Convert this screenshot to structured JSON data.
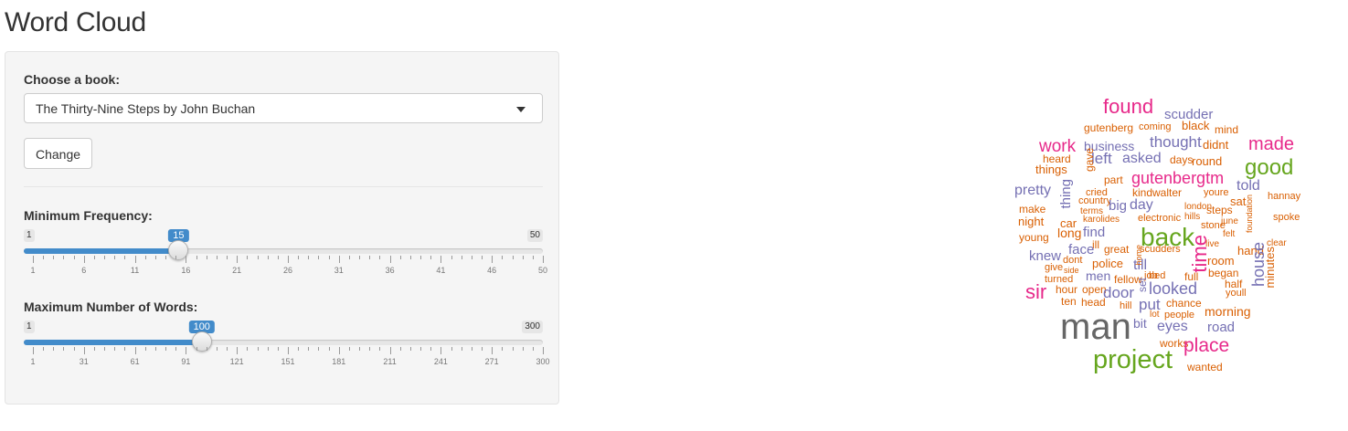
{
  "title": "Word Cloud",
  "book": {
    "label": "Choose a book:",
    "selected": "The Thirty-Nine Steps by John Buchan"
  },
  "change_button": "Change",
  "min_freq": {
    "label": "Minimum Frequency:",
    "min": 1,
    "max": 50,
    "value": 15,
    "min_label": "1",
    "max_label": "50",
    "value_label": "15",
    "ticks": [
      "1",
      "6",
      "11",
      "16",
      "21",
      "26",
      "31",
      "36",
      "41",
      "46",
      "50"
    ]
  },
  "max_words": {
    "label": "Maximum Number of Words:",
    "min": 1,
    "max": 300,
    "value": 100,
    "min_label": "1",
    "max_label": "300",
    "value_label": "100",
    "ticks": [
      "1",
      "31",
      "61",
      "91",
      "121",
      "151",
      "181",
      "211",
      "241",
      "271",
      "300"
    ]
  },
  "colors": {
    "accent": "#428bca",
    "cloud_palette": [
      "#666666",
      "#66a61e",
      "#e7298a",
      "#7570b3",
      "#d95f02"
    ]
  },
  "word_cloud": [
    {
      "text": "found",
      "color": "#e7298a"
    },
    {
      "text": "scudder",
      "color": "#7570b3"
    },
    {
      "text": "gutenberg",
      "color": "#d95f02"
    },
    {
      "text": "coming",
      "color": "#d95f02"
    },
    {
      "text": "black",
      "color": "#d95f02"
    },
    {
      "text": "mind",
      "color": "#d95f02"
    },
    {
      "text": "work",
      "color": "#e7298a"
    },
    {
      "text": "business",
      "color": "#7570b3"
    },
    {
      "text": "thought",
      "color": "#7570b3"
    },
    {
      "text": "didnt",
      "color": "#d95f02"
    },
    {
      "text": "made",
      "color": "#e7298a"
    },
    {
      "text": "heard",
      "color": "#d95f02"
    },
    {
      "text": "left",
      "color": "#7570b3"
    },
    {
      "text": "asked",
      "color": "#7570b3"
    },
    {
      "text": "days",
      "color": "#d95f02"
    },
    {
      "text": "round",
      "color": "#d95f02"
    },
    {
      "text": "good",
      "color": "#66a61e"
    },
    {
      "text": "things",
      "color": "#d95f02"
    },
    {
      "text": "gave",
      "color": "#d95f02"
    },
    {
      "text": "part",
      "color": "#d95f02"
    },
    {
      "text": "gutenbergtm",
      "color": "#e7298a"
    },
    {
      "text": "told",
      "color": "#7570b3"
    },
    {
      "text": "pretty",
      "color": "#7570b3"
    },
    {
      "text": "thing",
      "color": "#7570b3"
    },
    {
      "text": "cried",
      "color": "#d95f02"
    },
    {
      "text": "kindwalter",
      "color": "#d95f02"
    },
    {
      "text": "youre",
      "color": "#d95f02"
    },
    {
      "text": "sat",
      "color": "#d95f02"
    },
    {
      "text": "hannay",
      "color": "#d95f02"
    },
    {
      "text": "make",
      "color": "#d95f02"
    },
    {
      "text": "country",
      "color": "#d95f02"
    },
    {
      "text": "big",
      "color": "#7570b3"
    },
    {
      "text": "day",
      "color": "#7570b3"
    },
    {
      "text": "london",
      "color": "#d95f02"
    },
    {
      "text": "steps",
      "color": "#d95f02"
    },
    {
      "text": "terms",
      "color": "#d95f02"
    },
    {
      "text": "night",
      "color": "#d95f02"
    },
    {
      "text": "car",
      "color": "#d95f02"
    },
    {
      "text": "karolides",
      "color": "#d95f02"
    },
    {
      "text": "electronic",
      "color": "#d95f02"
    },
    {
      "text": "hills",
      "color": "#d95f02"
    },
    {
      "text": "june",
      "color": "#d95f02"
    },
    {
      "text": "foundation",
      "color": "#d95f02"
    },
    {
      "text": "spoke",
      "color": "#d95f02"
    },
    {
      "text": "back",
      "color": "#66a61e"
    },
    {
      "text": "stone",
      "color": "#d95f02"
    },
    {
      "text": "young",
      "color": "#d95f02"
    },
    {
      "text": "long",
      "color": "#d95f02"
    },
    {
      "text": "find",
      "color": "#7570b3"
    },
    {
      "text": "felt",
      "color": "#d95f02"
    },
    {
      "text": "ill",
      "color": "#d95f02"
    },
    {
      "text": "time",
      "color": "#e7298a"
    },
    {
      "text": "live",
      "color": "#d95f02"
    },
    {
      "text": "clear",
      "color": "#d95f02"
    },
    {
      "text": "knew",
      "color": "#7570b3"
    },
    {
      "text": "face",
      "color": "#7570b3"
    },
    {
      "text": "great",
      "color": "#d95f02"
    },
    {
      "text": "scudders",
      "color": "#d95f02"
    },
    {
      "text": "hand",
      "color": "#d95f02"
    },
    {
      "text": "house",
      "color": "#7570b3"
    },
    {
      "text": "dont",
      "color": "#d95f02"
    },
    {
      "text": "police",
      "color": "#d95f02"
    },
    {
      "text": "till",
      "color": "#7570b3"
    },
    {
      "text": "room",
      "color": "#d95f02"
    },
    {
      "text": "minutes",
      "color": "#d95f02"
    },
    {
      "text": "give",
      "color": "#d95f02"
    },
    {
      "text": "side",
      "color": "#d95f02"
    },
    {
      "text": "home",
      "color": "#d95f02"
    },
    {
      "text": "began",
      "color": "#d95f02"
    },
    {
      "text": "men",
      "color": "#7570b3"
    },
    {
      "text": "turned",
      "color": "#d95f02"
    },
    {
      "text": "fellow",
      "color": "#d95f02"
    },
    {
      "text": "job",
      "color": "#d95f02"
    },
    {
      "text": "bed",
      "color": "#d95f02"
    },
    {
      "text": "full",
      "color": "#d95f02"
    },
    {
      "text": "half",
      "color": "#d95f02"
    },
    {
      "text": "sir",
      "color": "#e7298a"
    },
    {
      "text": "hour",
      "color": "#d95f02"
    },
    {
      "text": "open",
      "color": "#d95f02"
    },
    {
      "text": "door",
      "color": "#7570b3"
    },
    {
      "text": "set",
      "color": "#7570b3"
    },
    {
      "text": "looked",
      "color": "#7570b3"
    },
    {
      "text": "youll",
      "color": "#d95f02"
    },
    {
      "text": "ten",
      "color": "#d95f02"
    },
    {
      "text": "head",
      "color": "#d95f02"
    },
    {
      "text": "hill",
      "color": "#d95f02"
    },
    {
      "text": "put",
      "color": "#7570b3"
    },
    {
      "text": "chance",
      "color": "#d95f02"
    },
    {
      "text": "lot",
      "color": "#d95f02"
    },
    {
      "text": "people",
      "color": "#d95f02"
    },
    {
      "text": "morning",
      "color": "#d95f02"
    },
    {
      "text": "man",
      "color": "#666666"
    },
    {
      "text": "bit",
      "color": "#7570b3"
    },
    {
      "text": "eyes",
      "color": "#7570b3"
    },
    {
      "text": "road",
      "color": "#7570b3"
    },
    {
      "text": "works",
      "color": "#d95f02"
    },
    {
      "text": "place",
      "color": "#e7298a"
    },
    {
      "text": "project",
      "color": "#66a61e"
    },
    {
      "text": "wanted",
      "color": "#d95f02"
    }
  ]
}
